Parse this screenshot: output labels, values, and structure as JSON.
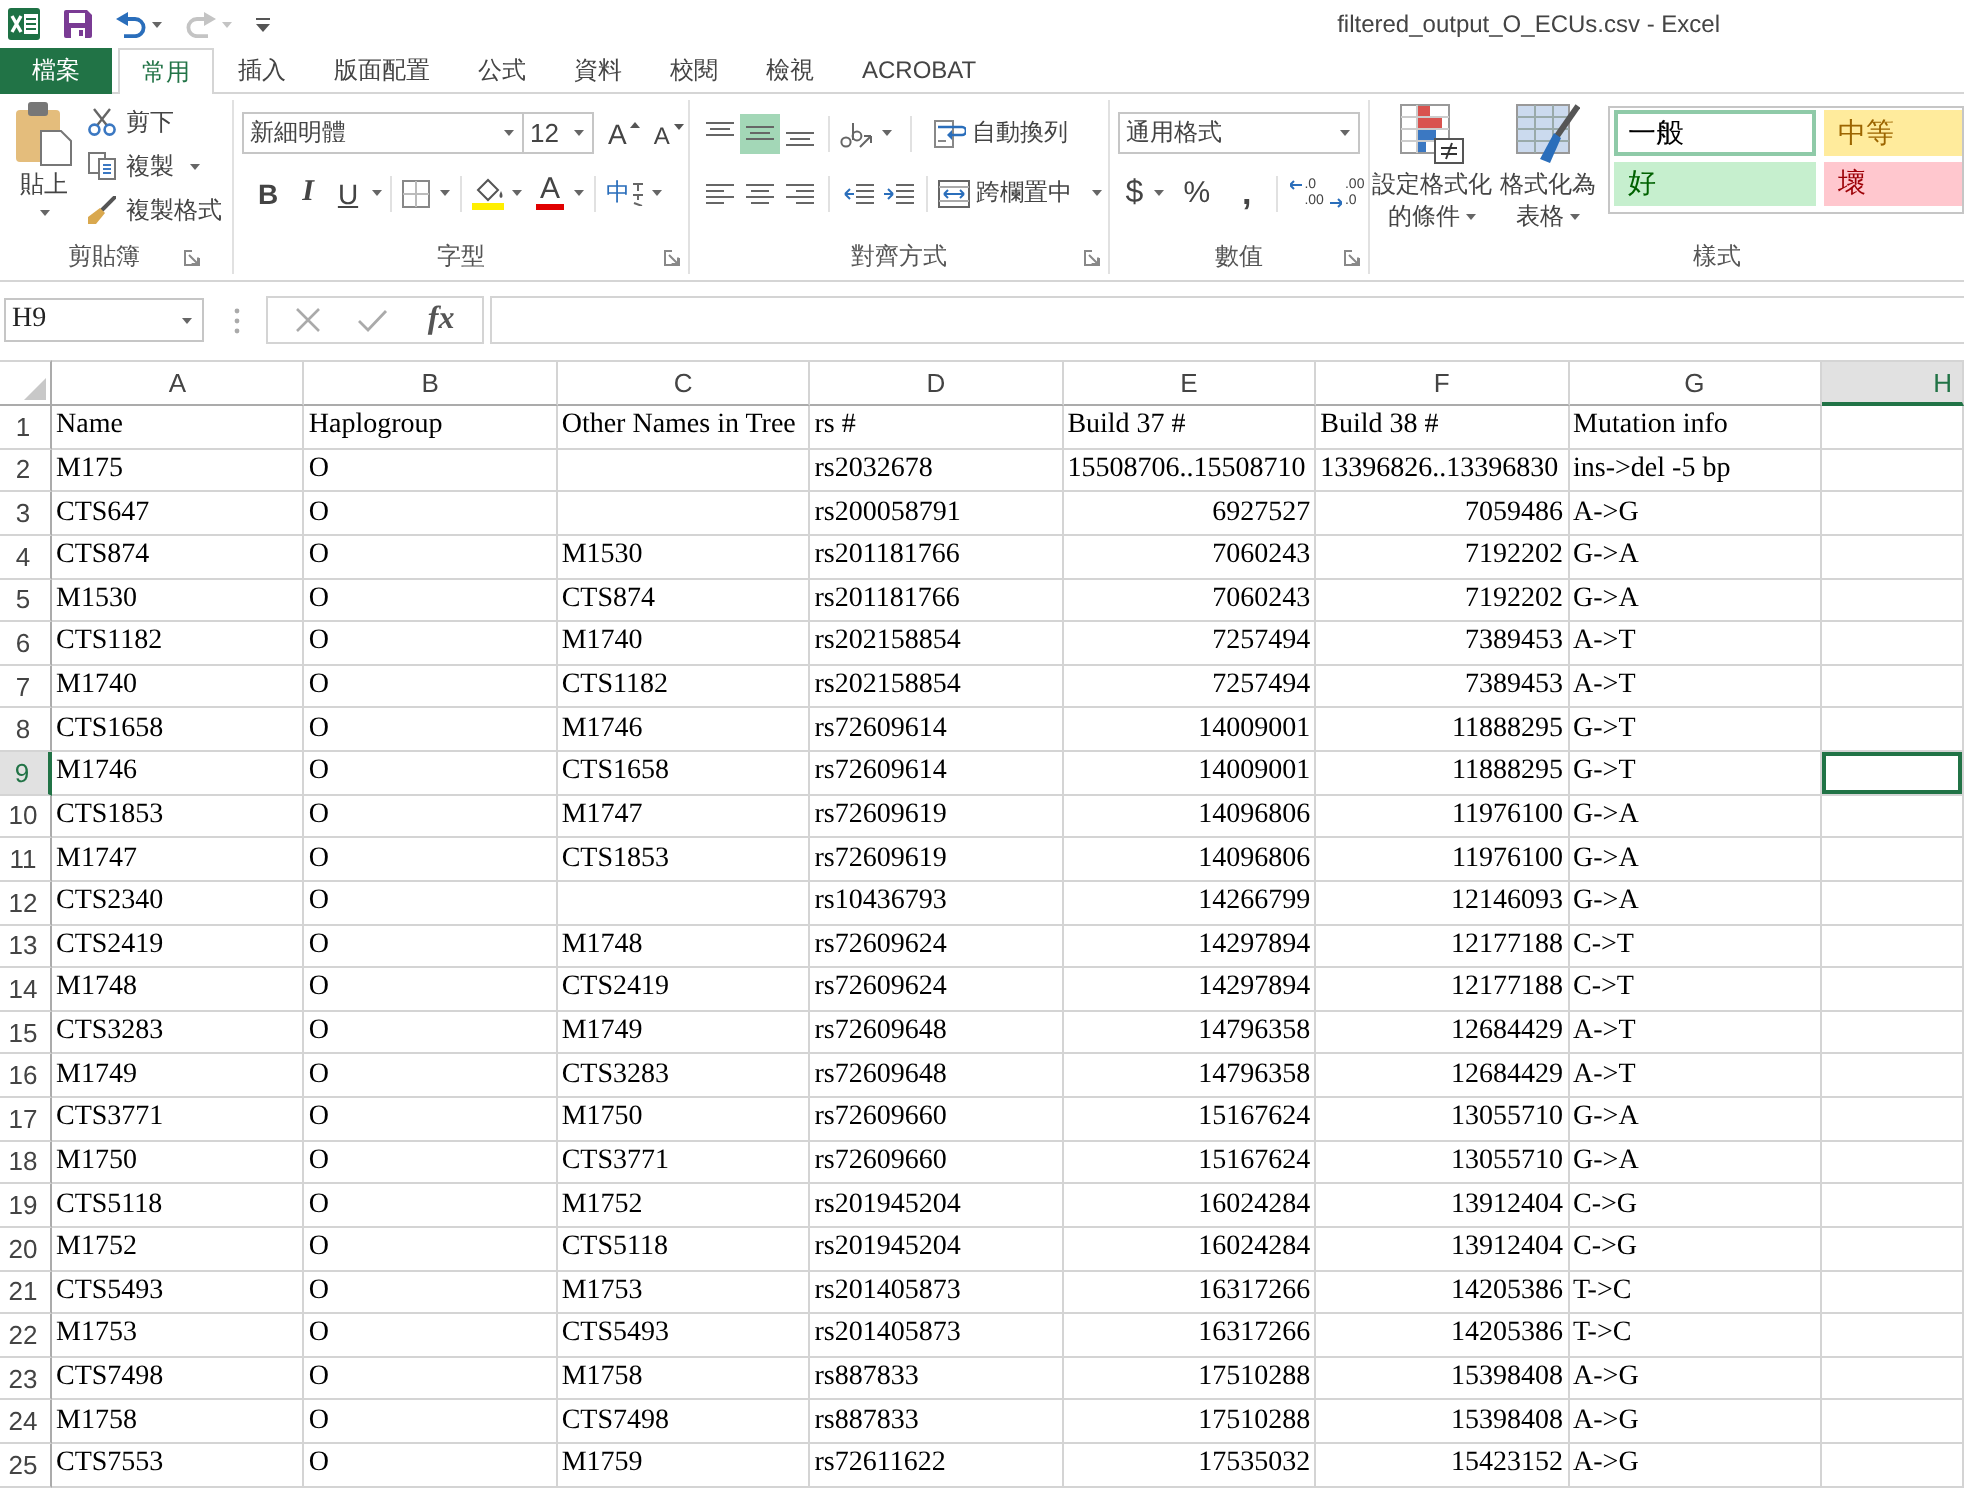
{
  "title_bar": {
    "quick_access": [
      {
        "kind": "save",
        "disabled": false
      },
      {
        "kind": "undo",
        "disabled": false
      },
      {
        "kind": "redo",
        "disabled": true
      },
      {
        "kind": "customize",
        "disabled": false
      }
    ],
    "title": "filtered_output_O_ECUs.csv - Excel"
  },
  "ribbon_tabs": [
    {
      "label": "檔案",
      "kind": "file",
      "selected": false
    },
    {
      "label": "常用",
      "kind": "tab",
      "selected": true
    },
    {
      "label": "插入",
      "kind": "tab",
      "selected": false
    },
    {
      "label": "版面配置",
      "kind": "tab",
      "selected": false
    },
    {
      "label": "公式",
      "kind": "tab",
      "selected": false
    },
    {
      "label": "資料",
      "kind": "tab",
      "selected": false
    },
    {
      "label": "校閱",
      "kind": "tab",
      "selected": false
    },
    {
      "label": "檢視",
      "kind": "tab",
      "selected": false
    },
    {
      "label": "ACROBAT",
      "kind": "tab",
      "selected": false
    }
  ],
  "ribbon": {
    "clipboard": {
      "label": "剪貼簿",
      "paste": "貼上",
      "cut": "剪下",
      "copy": "複製",
      "format_painter": "複製格式"
    },
    "font": {
      "label": "字型",
      "font_name": "新細明體",
      "font_size": "12",
      "grow_font": "A",
      "shrink_font": "A",
      "bold": "B",
      "italic": "I",
      "underline": "U",
      "font_color": "A",
      "phonetic": "中"
    },
    "alignment": {
      "label": "對齊方式",
      "vertical": [
        {
          "kind": "top",
          "selected": false
        },
        {
          "kind": "middle",
          "selected": true
        },
        {
          "kind": "bottom",
          "selected": false
        }
      ],
      "horizontal": [
        {
          "kind": "left",
          "selected": false
        },
        {
          "kind": "center",
          "selected": false
        },
        {
          "kind": "right",
          "selected": false
        }
      ],
      "wrap_text": "自動換列",
      "merge_center": "跨欄置中"
    },
    "number": {
      "label": "數值",
      "format": "通用格式",
      "currency": "$",
      "percent": "%",
      "comma": ",",
      "increase_decimal": [
        ".0",
        ".00"
      ],
      "decrease_decimal": [
        ".00",
        ".0"
      ]
    },
    "styles": {
      "label": "樣式",
      "conditional_formatting": [
        "設定格式化",
        "的條件"
      ],
      "format_as_table": [
        "格式化為",
        "表格"
      ],
      "cell_styles": [
        {
          "label": "一般",
          "kind": "normal",
          "selected": true
        },
        {
          "label": "中等",
          "kind": "neutral",
          "selected": false
        },
        {
          "label": "好",
          "kind": "good",
          "selected": false
        },
        {
          "label": "壞",
          "kind": "bad",
          "selected": false
        }
      ]
    }
  },
  "formula_bar": {
    "name_box": "H9",
    "insert_function": "fx"
  },
  "sheet": {
    "columns": [
      {
        "label": "A",
        "selected": false
      },
      {
        "label": "B",
        "selected": false
      },
      {
        "label": "C",
        "selected": false
      },
      {
        "label": "D",
        "selected": false
      },
      {
        "label": "E",
        "selected": false
      },
      {
        "label": "F",
        "selected": false
      },
      {
        "label": "G",
        "selected": false
      },
      {
        "label": "H",
        "selected": true
      }
    ],
    "rows": [
      {
        "label": "1",
        "selected": false,
        "cells": {
          "A": "Name",
          "B": "Haplogroup",
          "C": "Other Names in Tree",
          "D": "rs #",
          "E": "Build 37 #",
          "F": "Build 38 #",
          "G": "Mutation info"
        }
      },
      {
        "label": "2",
        "selected": false,
        "cells": {
          "A": "M175",
          "B": "O",
          "D": "rs2032678",
          "E": "15508706..15508710",
          "F": "13396826..13396830",
          "G": "ins->del -5 bp"
        }
      },
      {
        "label": "3",
        "selected": false,
        "cells": {
          "A": "CTS647",
          "B": "O",
          "D": "rs200058791",
          "E": {
            "text": "6927527",
            "kind": "number"
          },
          "F": {
            "text": "7059486",
            "kind": "number"
          },
          "G": "A->G"
        }
      },
      {
        "label": "4",
        "selected": false,
        "cells": {
          "A": "CTS874",
          "B": "O",
          "C": "M1530",
          "D": "rs201181766",
          "E": {
            "text": "7060243",
            "kind": "number"
          },
          "F": {
            "text": "7192202",
            "kind": "number"
          },
          "G": "G->A"
        }
      },
      {
        "label": "5",
        "selected": false,
        "cells": {
          "A": "M1530",
          "B": "O",
          "C": "CTS874",
          "D": "rs201181766",
          "E": {
            "text": "7060243",
            "kind": "number"
          },
          "F": {
            "text": "7192202",
            "kind": "number"
          },
          "G": "G->A"
        }
      },
      {
        "label": "6",
        "selected": false,
        "cells": {
          "A": "CTS1182",
          "B": "O",
          "C": "M1740",
          "D": "rs202158854",
          "E": {
            "text": "7257494",
            "kind": "number"
          },
          "F": {
            "text": "7389453",
            "kind": "number"
          },
          "G": "A->T"
        }
      },
      {
        "label": "7",
        "selected": false,
        "cells": {
          "A": "M1740",
          "B": "O",
          "C": "CTS1182",
          "D": "rs202158854",
          "E": {
            "text": "7257494",
            "kind": "number"
          },
          "F": {
            "text": "7389453",
            "kind": "number"
          },
          "G": "A->T"
        }
      },
      {
        "label": "8",
        "selected": false,
        "cells": {
          "A": "CTS1658",
          "B": "O",
          "C": "M1746",
          "D": "rs72609614",
          "E": {
            "text": "14009001",
            "kind": "number"
          },
          "F": {
            "text": "11888295",
            "kind": "number"
          },
          "G": "G->T"
        }
      },
      {
        "label": "9",
        "selected": true,
        "cells": {
          "A": "M1746",
          "B": "O",
          "C": "CTS1658",
          "D": "rs72609614",
          "E": {
            "text": "14009001",
            "kind": "number"
          },
          "F": {
            "text": "11888295",
            "kind": "number"
          },
          "G": "G->T"
        }
      },
      {
        "label": "10",
        "selected": false,
        "cells": {
          "A": "CTS1853",
          "B": "O",
          "C": "M1747",
          "D": "rs72609619",
          "E": {
            "text": "14096806",
            "kind": "number"
          },
          "F": {
            "text": "11976100",
            "kind": "number"
          },
          "G": "G->A"
        }
      },
      {
        "label": "11",
        "selected": false,
        "cells": {
          "A": "M1747",
          "B": "O",
          "C": "CTS1853",
          "D": "rs72609619",
          "E": {
            "text": "14096806",
            "kind": "number"
          },
          "F": {
            "text": "11976100",
            "kind": "number"
          },
          "G": "G->A"
        }
      },
      {
        "label": "12",
        "selected": false,
        "cells": {
          "A": "CTS2340",
          "B": "O",
          "D": "rs10436793",
          "E": {
            "text": "14266799",
            "kind": "number"
          },
          "F": {
            "text": "12146093",
            "kind": "number"
          },
          "G": "G->A"
        }
      },
      {
        "label": "13",
        "selected": false,
        "cells": {
          "A": "CTS2419",
          "B": "O",
          "C": "M1748",
          "D": "rs72609624",
          "E": {
            "text": "14297894",
            "kind": "number"
          },
          "F": {
            "text": "12177188",
            "kind": "number"
          },
          "G": "C->T"
        }
      },
      {
        "label": "14",
        "selected": false,
        "cells": {
          "A": "M1748",
          "B": "O",
          "C": "CTS2419",
          "D": "rs72609624",
          "E": {
            "text": "14297894",
            "kind": "number"
          },
          "F": {
            "text": "12177188",
            "kind": "number"
          },
          "G": "C->T"
        }
      },
      {
        "label": "15",
        "selected": false,
        "cells": {
          "A": "CTS3283",
          "B": "O",
          "C": "M1749",
          "D": "rs72609648",
          "E": {
            "text": "14796358",
            "kind": "number"
          },
          "F": {
            "text": "12684429",
            "kind": "number"
          },
          "G": "A->T"
        }
      },
      {
        "label": "16",
        "selected": false,
        "cells": {
          "A": "M1749",
          "B": "O",
          "C": "CTS3283",
          "D": "rs72609648",
          "E": {
            "text": "14796358",
            "kind": "number"
          },
          "F": {
            "text": "12684429",
            "kind": "number"
          },
          "G": "A->T"
        }
      },
      {
        "label": "17",
        "selected": false,
        "cells": {
          "A": "CTS3771",
          "B": "O",
          "C": "M1750",
          "D": "rs72609660",
          "E": {
            "text": "15167624",
            "kind": "number"
          },
          "F": {
            "text": "13055710",
            "kind": "number"
          },
          "G": "G->A"
        }
      },
      {
        "label": "18",
        "selected": false,
        "cells": {
          "A": "M1750",
          "B": "O",
          "C": "CTS3771",
          "D": "rs72609660",
          "E": {
            "text": "15167624",
            "kind": "number"
          },
          "F": {
            "text": "13055710",
            "kind": "number"
          },
          "G": "G->A"
        }
      },
      {
        "label": "19",
        "selected": false,
        "cells": {
          "A": "CTS5118",
          "B": "O",
          "C": "M1752",
          "D": "rs201945204",
          "E": {
            "text": "16024284",
            "kind": "number"
          },
          "F": {
            "text": "13912404",
            "kind": "number"
          },
          "G": "C->G"
        }
      },
      {
        "label": "20",
        "selected": false,
        "cells": {
          "A": "M1752",
          "B": "O",
          "C": "CTS5118",
          "D": "rs201945204",
          "E": {
            "text": "16024284",
            "kind": "number"
          },
          "F": {
            "text": "13912404",
            "kind": "number"
          },
          "G": "C->G"
        }
      },
      {
        "label": "21",
        "selected": false,
        "cells": {
          "A": "CTS5493",
          "B": "O",
          "C": "M1753",
          "D": "rs201405873",
          "E": {
            "text": "16317266",
            "kind": "number"
          },
          "F": {
            "text": "14205386",
            "kind": "number"
          },
          "G": "T->C"
        }
      },
      {
        "label": "22",
        "selected": false,
        "cells": {
          "A": "M1753",
          "B": "O",
          "C": "CTS5493",
          "D": "rs201405873",
          "E": {
            "text": "16317266",
            "kind": "number"
          },
          "F": {
            "text": "14205386",
            "kind": "number"
          },
          "G": "T->C"
        }
      },
      {
        "label": "23",
        "selected": false,
        "cells": {
          "A": "CTS7498",
          "B": "O",
          "C": "M1758",
          "D": "rs887833",
          "E": {
            "text": "17510288",
            "kind": "number"
          },
          "F": {
            "text": "15398408",
            "kind": "number"
          },
          "G": "A->G"
        }
      },
      {
        "label": "24",
        "selected": false,
        "cells": {
          "A": "M1758",
          "B": "O",
          "C": "CTS7498",
          "D": "rs887833",
          "E": {
            "text": "17510288",
            "kind": "number"
          },
          "F": {
            "text": "15398408",
            "kind": "number"
          },
          "G": "A->G"
        }
      },
      {
        "label": "25",
        "selected": false,
        "cells": {
          "A": "CTS7553",
          "B": "O",
          "C": "M1759",
          "D": "rs72611622",
          "E": {
            "text": "17535032",
            "kind": "number"
          },
          "F": {
            "text": "15423152",
            "kind": "number"
          },
          "G": "A->G"
        }
      }
    ]
  }
}
